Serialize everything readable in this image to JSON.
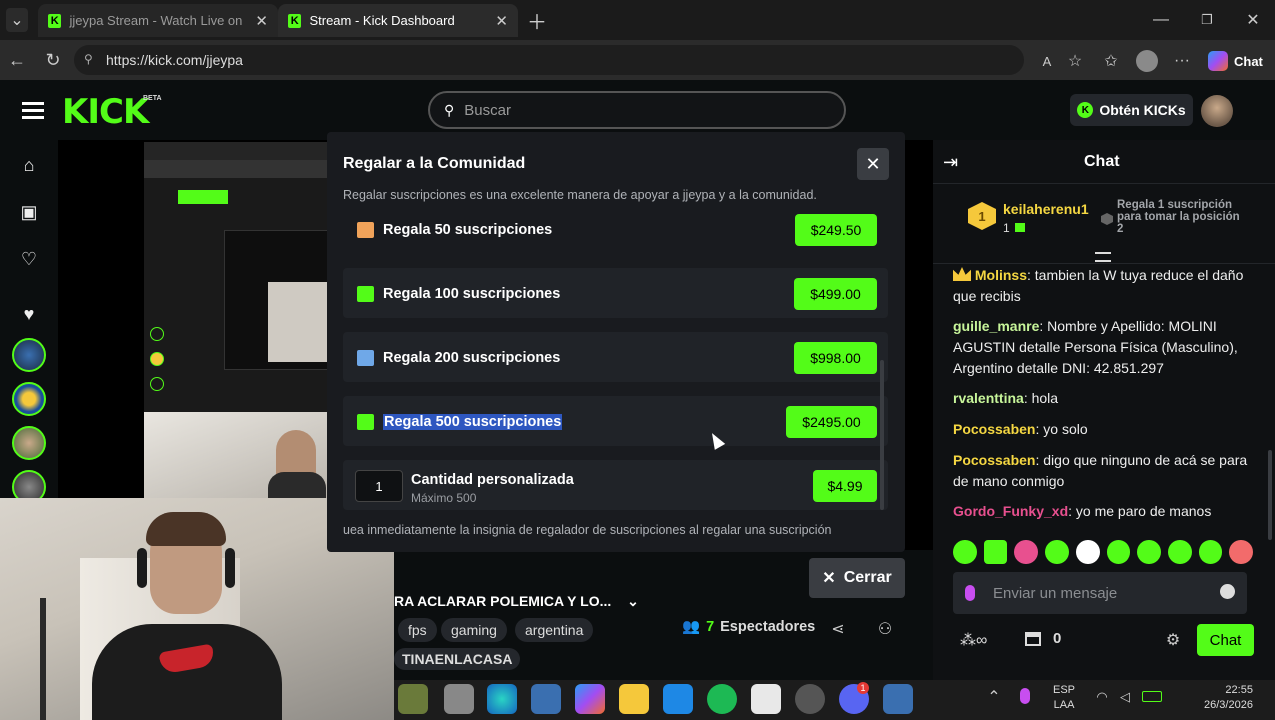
{
  "tabs": [
    {
      "label": "jjeypa Stream - Watch Live on Kick"
    },
    {
      "label": "Stream - Kick Dashboard"
    }
  ],
  "address": {
    "url": "https://kick.com/jjeypa"
  },
  "browser": {
    "chat_label": "Chat"
  },
  "header": {
    "logo": "KICK",
    "beta": "BETA",
    "search_placeholder": "Buscar",
    "get_kicks": "Obtén KICKs"
  },
  "modal": {
    "title": "Regalar a la Comunidad",
    "subtitle": "Regalar suscripciones es una excelente manera de apoyar a jjeypa y a la comunidad.",
    "options": [
      {
        "label": "Regala 50 suscripciones",
        "price": "$249.50",
        "color": "#f0a35a"
      },
      {
        "label": "Regala 100 suscripciones",
        "price": "$499.00",
        "color": "#53fc18"
      },
      {
        "label": "Regala 200 suscripciones",
        "price": "$998.00",
        "color": "#6fa8e8"
      },
      {
        "label": "Regala 500 suscripciones",
        "price": "$2495.00",
        "color": "#53fc18"
      }
    ],
    "custom": {
      "qty": "1",
      "label": "Cantidad personalizada",
      "sublabel": "Máximo 500",
      "price": "$4.99"
    },
    "footer": "uea inmediatamente la insignia de regalador de suscripciones al regalar una suscripción",
    "close_label": "Cerrar"
  },
  "stream": {
    "title": "RA ACLARAR POLEMICA Y LO...",
    "tags": [
      "fps",
      "gaming",
      "argentina"
    ],
    "category": "TINAENLACASA",
    "viewers_count": "7",
    "viewers_label": "Espectadores"
  },
  "chat": {
    "title": "Chat",
    "pinned": {
      "rank": "1",
      "user": "keilaherenu1",
      "count": "1",
      "note": "Regala 1 suscripción para tomar la posición 2"
    },
    "messages": [
      {
        "user": "Molinss",
        "text": ": tambien la W tuya reduce el daño que recibis",
        "color": "#f5d742"
      },
      {
        "user": "guille_manre",
        "text": ": Nombre y Apellido: MOLINI AGUSTIN detalle Persona Física (Masculino), Argentino detalle DNI: 42.851.297",
        "color": "#c7f59a"
      },
      {
        "user": "rvalenttina",
        "text": ": hola",
        "color": "#c7f59a"
      },
      {
        "user": "Pocossaben",
        "text": ": yo solo",
        "color": "#f5d742"
      },
      {
        "user": "Pocossaben",
        "text": ": digo que ninguno de acá se para de mano conmigo",
        "color": "#f5d742"
      },
      {
        "user": "Gordo_Funky_xd",
        "text": ": yo me paro de manos",
        "color": "#e8508f"
      }
    ],
    "input_placeholder": "Enviar un mensaje",
    "points": "0",
    "send_label": "Chat"
  },
  "taskbar": {
    "lang": "ESP",
    "layout": "LAA",
    "time": "22:55",
    "date": "26/3/2026",
    "discord_badge": "1"
  }
}
